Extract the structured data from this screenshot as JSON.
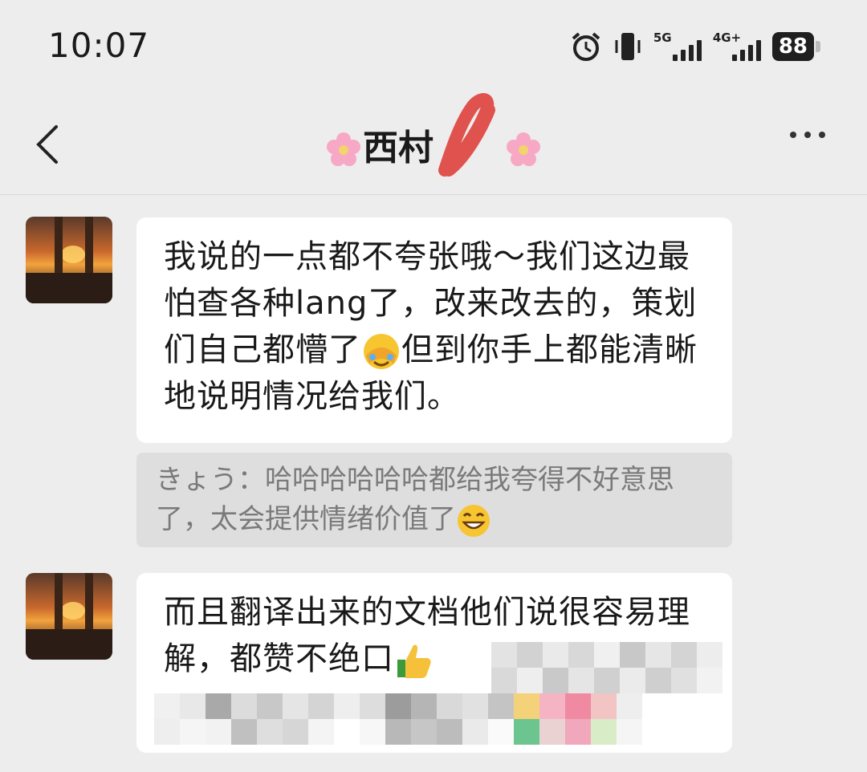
{
  "status_bar": {
    "time": "10:07",
    "network_1": "5G",
    "network_2": "4G+",
    "battery": "88",
    "icons": [
      "alarm-icon",
      "vibrate-icon",
      "signal-icon",
      "signal-icon",
      "battery-icon"
    ]
  },
  "header": {
    "title_visible": "西村",
    "decorations": [
      "cherry-blossom-icon",
      "cherry-blossom-icon"
    ]
  },
  "messages": [
    {
      "text_before_emoji": "我说的一点都不夸张哦～我们这边最怕查各种lang了，改来改去的，策划们自己都懵了",
      "emoji": "face-palm-emoji",
      "text_after_emoji": "但到你手上都能清晰地说明情况给我们。",
      "quote": {
        "author": "きょう",
        "separator": "：",
        "text": "哈哈哈哈哈哈都给我夸得不好意思了，太会提供情绪价值了",
        "emoji": "grinning-emoji"
      }
    },
    {
      "text_before_emoji": "而且翻译出来的文档他们说很容易理解，都赞不绝口",
      "emoji": "thumbs-up-emoji"
    }
  ],
  "colors": {
    "background": "#ededed",
    "bubble": "#ffffff",
    "quote_bg": "#dedede",
    "redaction": "#e0524e"
  }
}
